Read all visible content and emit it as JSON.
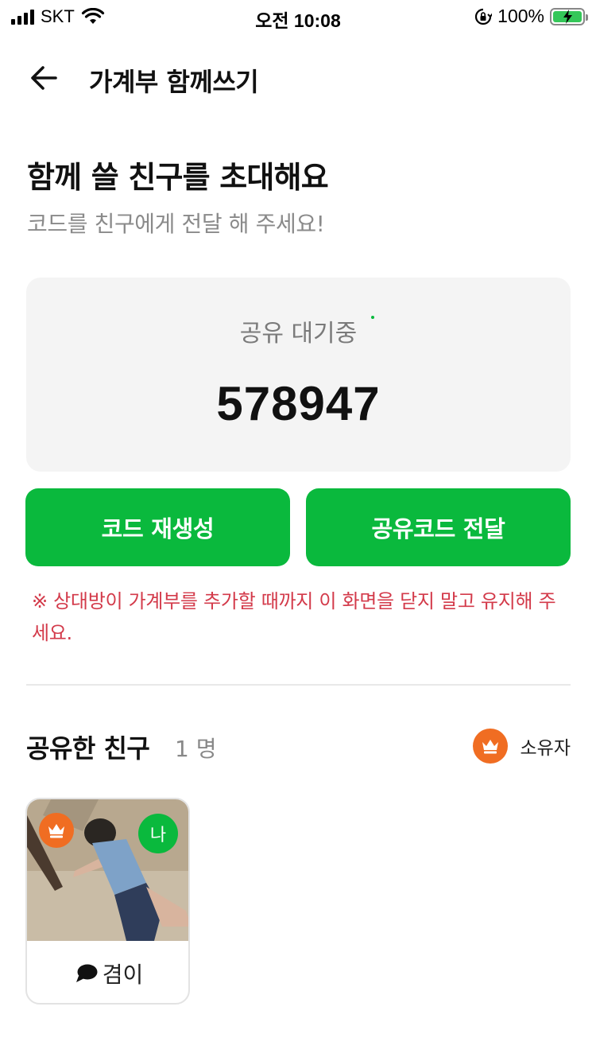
{
  "status_bar": {
    "carrier": "SKT",
    "time": "오전 10:08",
    "battery": "100%",
    "icons": [
      "signal-icon",
      "wifi-icon",
      "orientation-lock-icon",
      "battery-charging-icon"
    ]
  },
  "header": {
    "title": "가계부 함께쓰기",
    "back_icon": "back-arrow-icon"
  },
  "main": {
    "heading": "함께 쓸 친구를 초대해요",
    "subheading": "코드를 친구에게 전달 해 주세요!",
    "code_card": {
      "status": "공유 대기중",
      "code": "578947"
    },
    "buttons": {
      "regenerate": "코드 재생성",
      "send": "공유코드 전달"
    },
    "warning": "※ 상대방이 가계부를 추가할 때까지 이 화면을 닫지 말고 유지해 주세요."
  },
  "friends": {
    "title": "공유한 친구",
    "count": "1 명",
    "legend_label": "소유자",
    "list": [
      {
        "name": "겸이",
        "me_badge": "나",
        "is_owner": true
      }
    ]
  },
  "colors": {
    "accent_green": "#0ab93d",
    "owner_orange": "#f06d22",
    "warning_red": "#d33a4a",
    "card_bg": "#f4f4f4"
  }
}
